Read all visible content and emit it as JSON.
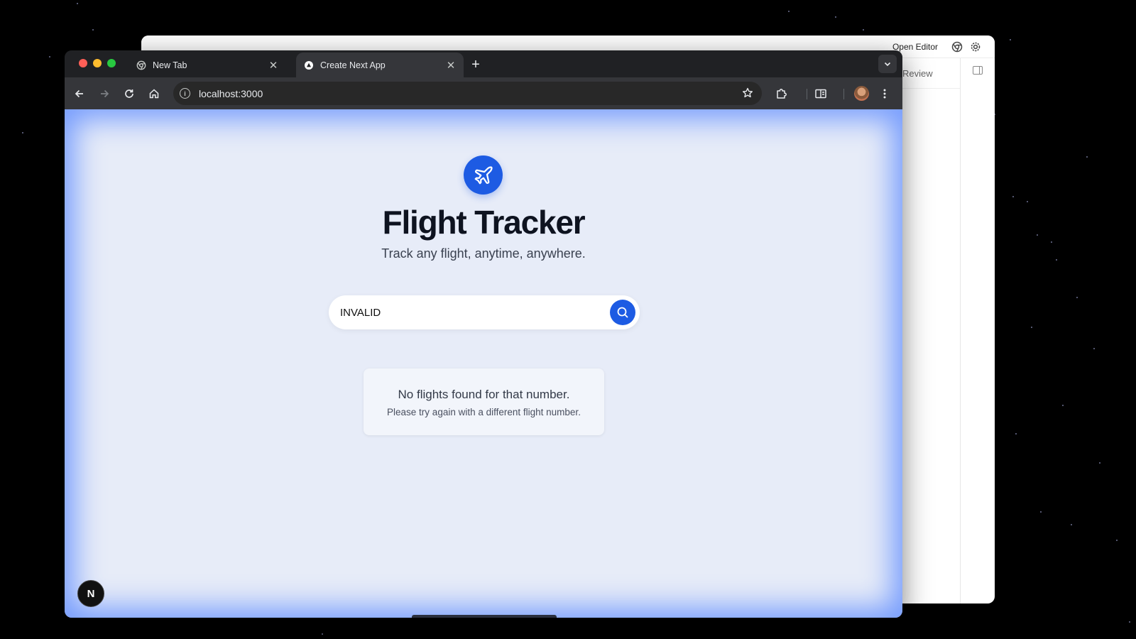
{
  "background_window": {
    "open_editor_label": "Open Editor",
    "review_label": "Review"
  },
  "browser": {
    "tabs": [
      {
        "title": "New Tab",
        "favicon": "chrome-icon",
        "active": false
      },
      {
        "title": "Create Next App",
        "favicon": "nextjs-triangle-icon",
        "active": true
      }
    ],
    "address_bar": {
      "url": "localhost:3000"
    }
  },
  "page": {
    "title": "Flight Tracker",
    "subtitle": "Track any flight, anytime, anywhere.",
    "search": {
      "value": "INVALID"
    },
    "message": {
      "title": "No flights found for that number.",
      "detail": "Please try again with a different flight number."
    },
    "next_badge": "N"
  },
  "colors": {
    "accent": "#1d5be3",
    "page_background": "#e7ecf8",
    "title_text": "#0e1320"
  }
}
